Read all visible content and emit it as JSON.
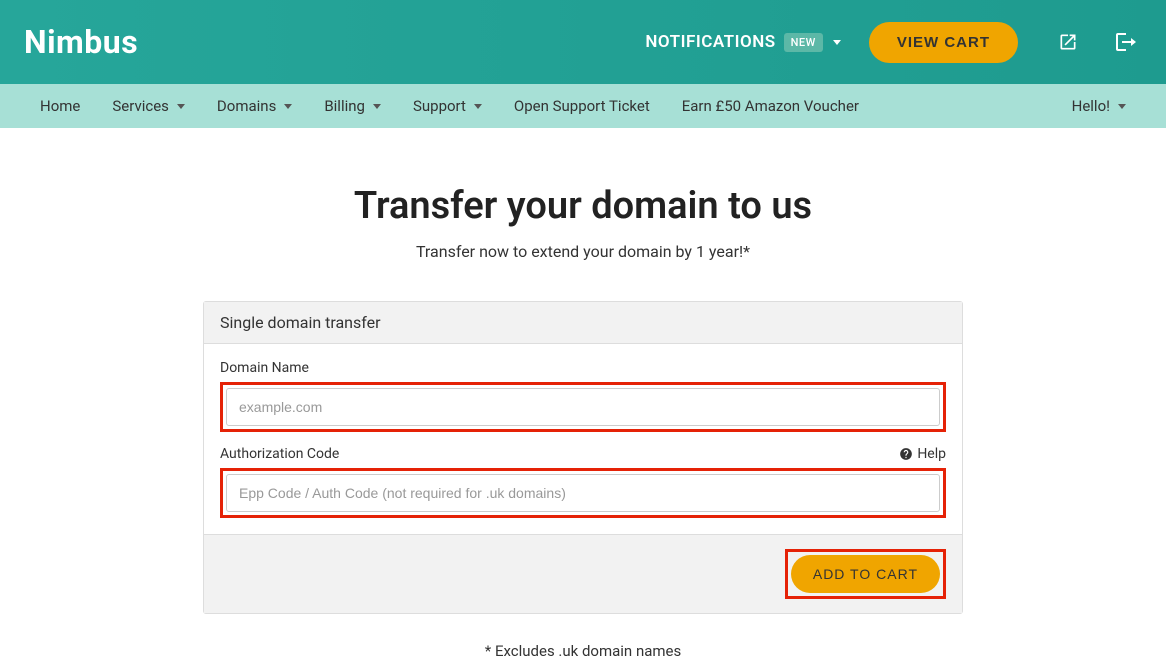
{
  "topbar": {
    "logo": "Nimbus",
    "notifications_label": "NOTIFICATIONS",
    "new_badge": "NEW",
    "view_cart": "VIEW CART"
  },
  "nav": {
    "items": [
      {
        "label": "Home",
        "dropdown": false
      },
      {
        "label": "Services",
        "dropdown": true
      },
      {
        "label": "Domains",
        "dropdown": true
      },
      {
        "label": "Billing",
        "dropdown": true
      },
      {
        "label": "Support",
        "dropdown": true
      },
      {
        "label": "Open Support Ticket",
        "dropdown": false
      },
      {
        "label": "Earn £50 Amazon Voucher",
        "dropdown": false
      }
    ],
    "greeting": "Hello!"
  },
  "page": {
    "title": "Transfer your domain to us",
    "subtitle": "Transfer now to extend your domain by 1 year!*",
    "panel_header": "Single domain transfer",
    "domain_label": "Domain Name",
    "domain_placeholder": "example.com",
    "auth_label": "Authorization Code",
    "auth_placeholder": "Epp Code / Auth Code (not required for .uk domains)",
    "help_label": "Help",
    "add_to_cart": "ADD TO CART",
    "footnote": "* Excludes .uk domain names"
  }
}
